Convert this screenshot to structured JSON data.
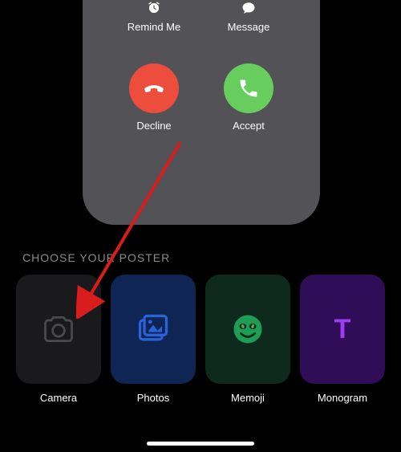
{
  "call": {
    "remind_label": "Remind Me",
    "message_label": "Message",
    "decline_label": "Decline",
    "accept_label": "Accept"
  },
  "section_header": "CHOOSE YOUR POSTER",
  "posters": {
    "camera": {
      "label": "Camera"
    },
    "photos": {
      "label": "Photos"
    },
    "memoji": {
      "label": "Memoji"
    },
    "monogram": {
      "label": "Monogram",
      "letter": "T"
    }
  }
}
